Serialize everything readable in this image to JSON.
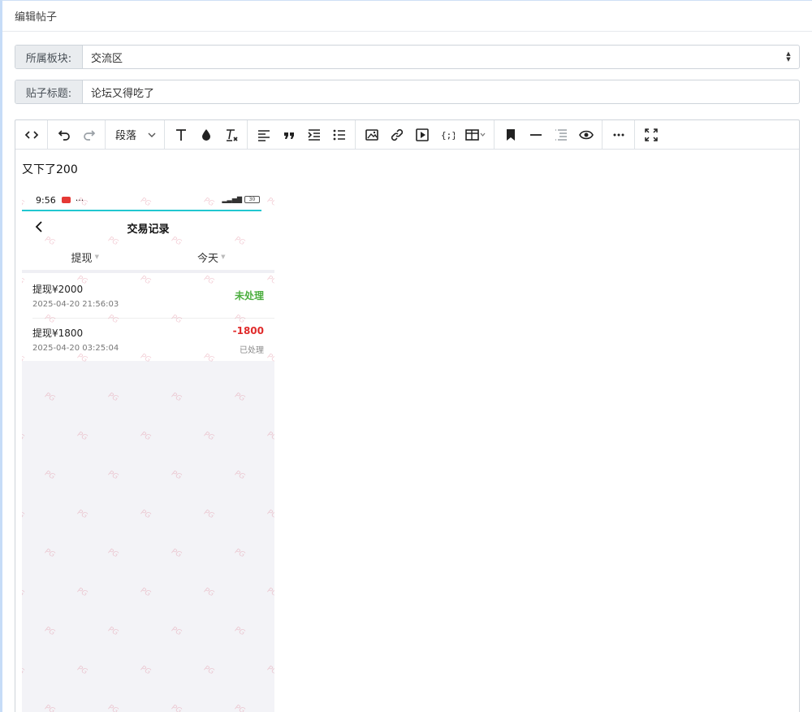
{
  "header": {
    "title": "编辑帖子"
  },
  "board_field": {
    "label": "所属板块:",
    "value": "交流区"
  },
  "title_field": {
    "label": "贴子标题:",
    "value": "论坛又得吃了"
  },
  "toolbar": {
    "paragraph_label": "段落",
    "buttons": [
      "code-view",
      "undo",
      "redo",
      "font-size",
      "font-color",
      "clear-format",
      "align",
      "blockquote",
      "indent",
      "bullet-list",
      "insert-image",
      "insert-link",
      "insert-video",
      "code-block",
      "insert-table",
      "bookmark",
      "divider",
      "todo",
      "preview",
      "more",
      "fullscreen"
    ]
  },
  "content": {
    "text": "又下了200",
    "screenshot": {
      "time": "9:56",
      "dots": "···",
      "battery": "30",
      "nav_title": "交易记录",
      "filter_type": "提现",
      "filter_date": "今天",
      "watermark": "PG",
      "records": [
        {
          "title": "提现¥2000",
          "date": "2025-04-20 21:56:03",
          "status": "未处理",
          "amount": ""
        },
        {
          "title": "提现¥1800",
          "date": "2025-04-20 03:25:04",
          "status": "已处理",
          "amount": "-1800"
        }
      ]
    }
  },
  "colors": {
    "accent": "#22c7d0",
    "pending": "#4cae3f",
    "negative": "#e02b2b"
  }
}
